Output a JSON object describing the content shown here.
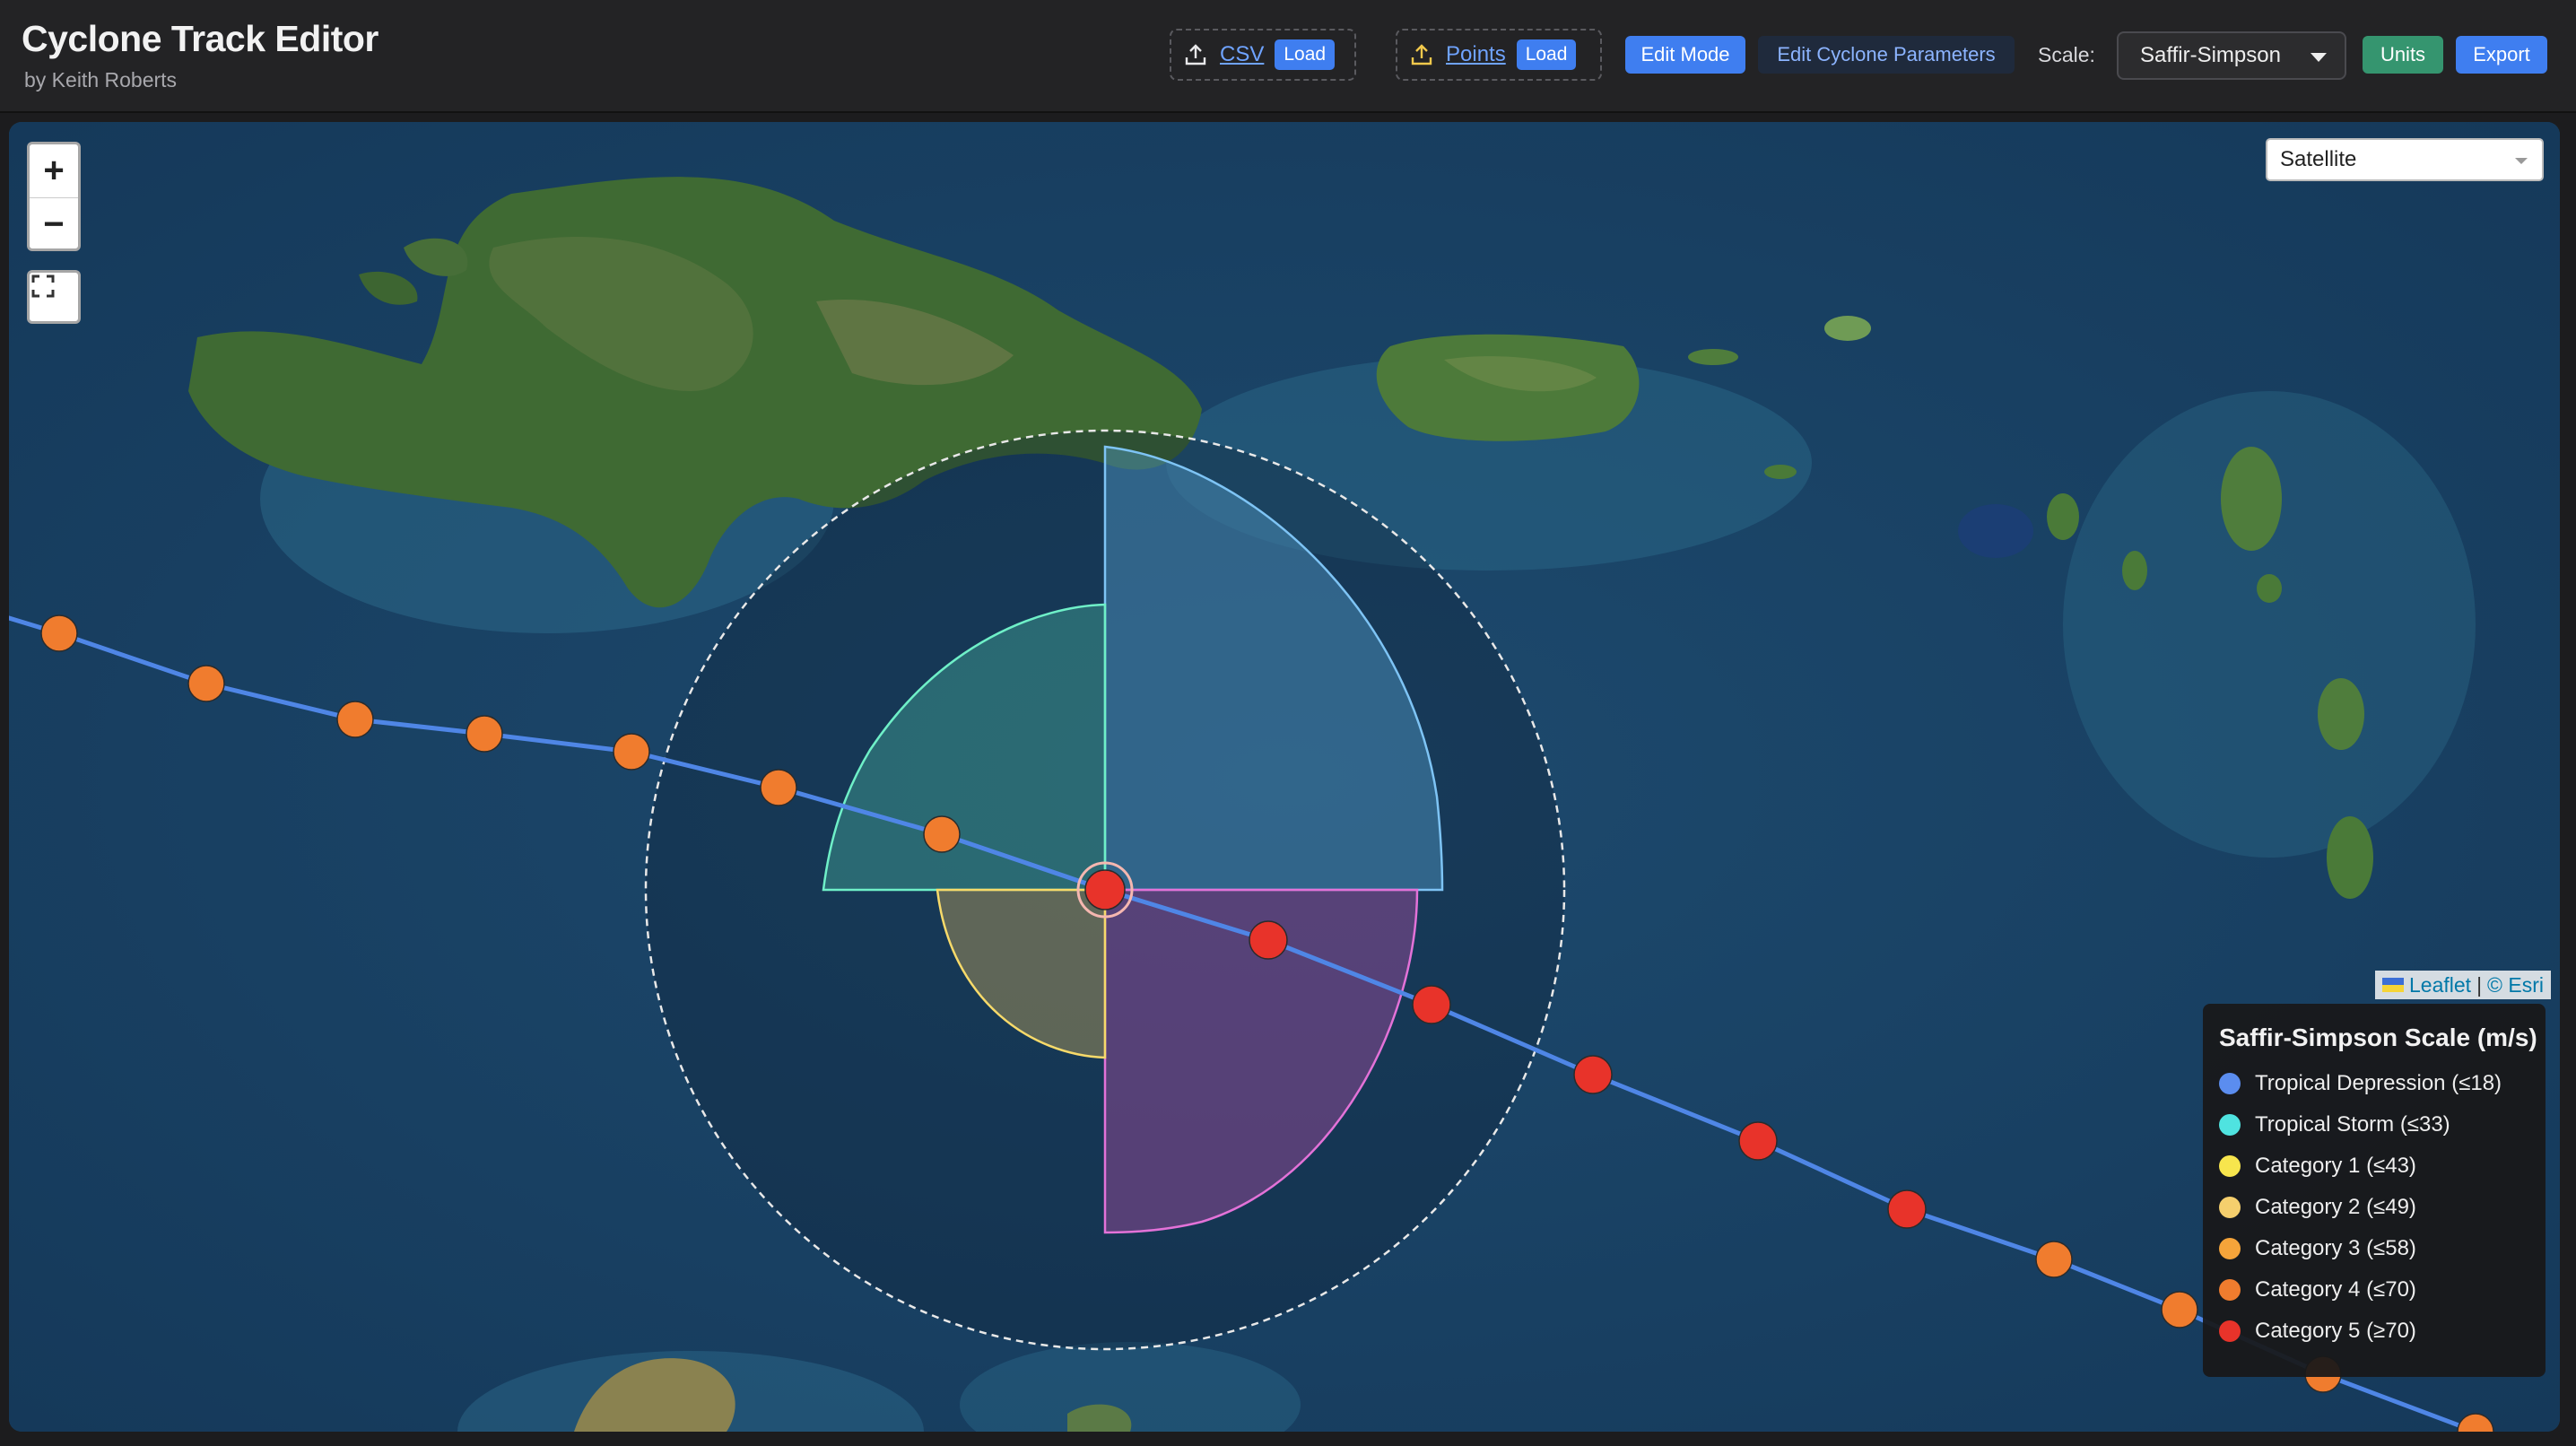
{
  "app": {
    "title": "Cyclone Track Editor",
    "subtitle": "by Keith Roberts"
  },
  "toolbar": {
    "csv": {
      "link": "CSV",
      "load": "Load",
      "icon": "upload-icon"
    },
    "points": {
      "link": "Points",
      "load": "Load",
      "icon": "upload-icon"
    },
    "edit_mode": "Edit Mode",
    "edit_params": "Edit Cyclone Parameters",
    "scale_label": "Scale:",
    "scale_value": "Saffir-Simpson",
    "units": "Units",
    "export": "Export"
  },
  "map": {
    "basemap": "Satellite",
    "zoom_in": "+",
    "zoom_out": "−",
    "attribution": {
      "leaflet": "Leaflet",
      "sep": "|",
      "esri": "© Esri"
    }
  },
  "legend": {
    "title": "Saffir-Simpson Scale (m/s)",
    "items": [
      {
        "label": "Tropical Depression (≤18)",
        "color": "#5b8def"
      },
      {
        "label": "Tropical Storm (≤33)",
        "color": "#4fe3e0"
      },
      {
        "label": "Category 1 (≤43)",
        "color": "#f7e54d"
      },
      {
        "label": "Category 2 (≤49)",
        "color": "#f5cf6d"
      },
      {
        "label": "Category 3 (≤58)",
        "color": "#f5a43a"
      },
      {
        "label": "Category 4 (≤70)",
        "color": "#f07c2e"
      },
      {
        "label": "Category 5 (≥70)",
        "color": "#e8332a"
      }
    ]
  },
  "colors": {
    "track": "#4f86e6",
    "cat4": "#f07c2e",
    "cat5": "#e8332a"
  }
}
